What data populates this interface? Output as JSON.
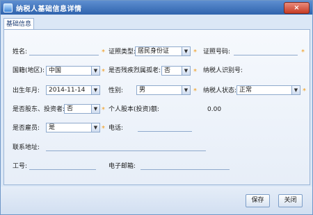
{
  "window": {
    "title": "纳税人基础信息详情",
    "close_label": "×"
  },
  "tab": {
    "label": "基础信息"
  },
  "fields": {
    "name_label": "姓名:",
    "id_type_label": "证照类型:",
    "id_type_value": "居民身份证",
    "id_number_label": "证照号码:",
    "country_label": "国籍(地区):",
    "country_value": "中国",
    "disabled_label": "是否残疾烈属孤老:",
    "disabled_value": "否",
    "taxpayer_id_label": "纳税人识别号:",
    "birth_label": "出生年月:",
    "birth_value": "2014-11-14",
    "gender_label": "性别:",
    "gender_value": "男",
    "taxpayer_status_label": "纳税人状态:",
    "taxpayer_status_value": "正常",
    "shareholder_label": "是否股东、投资者:",
    "shareholder_value": "否",
    "equity_label": "个人股本(投资)额:",
    "equity_value": "0.00",
    "employee_label": "是否雇员:",
    "employee_value": "是",
    "phone_label": "电话:",
    "address_label": "联系地址:",
    "employee_no_label": "工号:",
    "email_label": "电子邮箱:"
  },
  "buttons": {
    "save": "保存",
    "close": "关闭"
  },
  "colors": {
    "title_bar": "#2f63ad",
    "required_marker": "#f09a1a",
    "panel_bg": "#e7eef8"
  }
}
